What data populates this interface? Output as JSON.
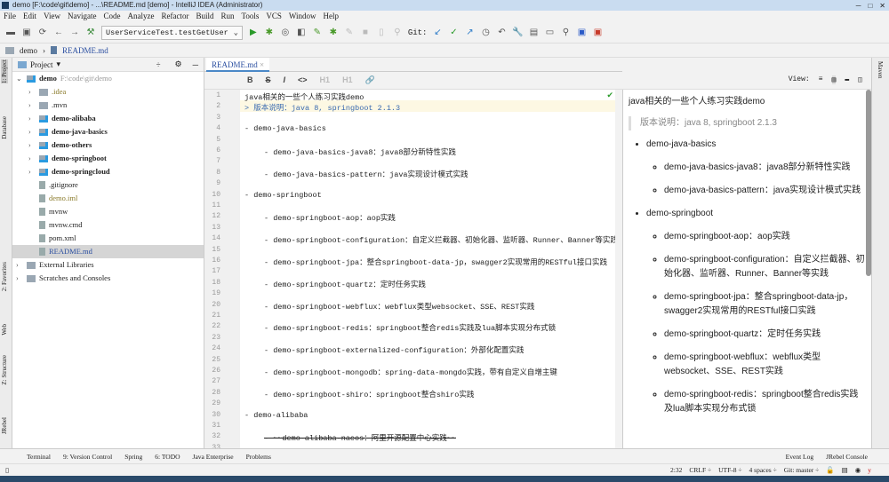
{
  "window": {
    "title": "demo [F:\\code\\git\\demo] - ...\\README.md [demo] - IntelliJ IDEA (Administrator)"
  },
  "menu": [
    "File",
    "Edit",
    "View",
    "Navigate",
    "Code",
    "Analyze",
    "Refactor",
    "Build",
    "Run",
    "Tools",
    "VCS",
    "Window",
    "Help"
  ],
  "toolbar": {
    "run_config": "UserServiceTest.testGetUser",
    "git_label": "Git:"
  },
  "breadcrumb": [
    "demo",
    "README.md"
  ],
  "left_stripe": [
    "1: Project",
    "Database",
    "2: Favorites",
    "Web",
    "Z: Structure",
    "JRebel"
  ],
  "right_stripe": [
    "Maven"
  ],
  "project": {
    "header": "Project",
    "tree": [
      {
        "name": "demo",
        "extra": "F:\\code\\git\\demo",
        "type": "module",
        "level": 0,
        "expanded": true
      },
      {
        "name": ".idea",
        "type": "folder",
        "level": 1
      },
      {
        "name": ".mvn",
        "type": "folder",
        "level": 1
      },
      {
        "name": "demo-alibaba",
        "type": "module",
        "level": 1
      },
      {
        "name": "demo-java-basics",
        "type": "module",
        "level": 1
      },
      {
        "name": "demo-others",
        "type": "module",
        "level": 1
      },
      {
        "name": "demo-springboot",
        "type": "module",
        "level": 1
      },
      {
        "name": "demo-springcloud",
        "type": "module",
        "level": 1
      },
      {
        "name": ".gitignore",
        "type": "file",
        "level": 1
      },
      {
        "name": "demo.iml",
        "type": "file",
        "level": 1
      },
      {
        "name": "mvnw",
        "type": "file",
        "level": 1
      },
      {
        "name": "mvnw.cmd",
        "type": "file",
        "level": 1
      },
      {
        "name": "pom.xml",
        "type": "file",
        "level": 1
      },
      {
        "name": "README.md",
        "type": "file",
        "level": 1,
        "selected": true
      },
      {
        "name": "External Libraries",
        "type": "lib",
        "level": 0
      },
      {
        "name": "Scratches and Consoles",
        "type": "lib",
        "level": 0
      }
    ]
  },
  "editor": {
    "tab": "README.md",
    "md_tools": [
      "B",
      "S",
      "I",
      "<>",
      "H1",
      "H1",
      "🔗"
    ],
    "view_label": "View:",
    "lines": [
      {
        "n": 1,
        "t": "java相关的一些个人练习实践demo",
        "i": 0
      },
      {
        "n": 2,
        "t": "> 版本说明：java 8, springboot 2.1.3",
        "i": 0,
        "q": true
      },
      {
        "n": 3,
        "t": "",
        "i": 0
      },
      {
        "n": 4,
        "t": "- demo-java-basics",
        "i": 0
      },
      {
        "n": 5,
        "t": "",
        "i": 0
      },
      {
        "n": 6,
        "t": "- demo-java-basics-java8：java8部分新特性实践",
        "i": 1
      },
      {
        "n": 7,
        "t": "",
        "i": 0
      },
      {
        "n": 8,
        "t": "- demo-java-basics-pattern：java实现设计模式实践",
        "i": 1
      },
      {
        "n": 9,
        "t": "",
        "i": 0
      },
      {
        "n": 10,
        "t": "- demo-springboot",
        "i": 0
      },
      {
        "n": 11,
        "t": "",
        "i": 0
      },
      {
        "n": 12,
        "t": "- demo-springboot-aop：aop实践",
        "i": 1
      },
      {
        "n": 13,
        "t": "",
        "i": 0
      },
      {
        "n": 14,
        "t": "- demo-springboot-configuration：自定义拦截器、初始化器、监听器、Runner、Banner等实践",
        "i": 1
      },
      {
        "n": 15,
        "t": "",
        "i": 0
      },
      {
        "n": 16,
        "t": "- demo-springboot-jpa：整合springboot-data-jp，swagger2实现常用的RESTful接口实践",
        "i": 1
      },
      {
        "n": 17,
        "t": "",
        "i": 0
      },
      {
        "n": 18,
        "t": "- demo-springboot-quartz：定时任务实践",
        "i": 1
      },
      {
        "n": 19,
        "t": "",
        "i": 0
      },
      {
        "n": 20,
        "t": "- demo-springboot-webflux：webflux类型websocket、SSE、REST实践",
        "i": 1
      },
      {
        "n": 21,
        "t": "",
        "i": 0
      },
      {
        "n": 22,
        "t": "- demo-springboot-redis：springboot整合redis实践及lua脚本实现分布式锁",
        "i": 1
      },
      {
        "n": 23,
        "t": "",
        "i": 0
      },
      {
        "n": 24,
        "t": "- demo-springboot-externalized-configuration：外部化配置实践",
        "i": 1
      },
      {
        "n": 25,
        "t": "",
        "i": 0
      },
      {
        "n": 26,
        "t": "- demo-springboot-mongodb：spring-data-mongdo实践，带有自定义自增主键",
        "i": 1
      },
      {
        "n": 27,
        "t": "",
        "i": 0
      },
      {
        "n": 28,
        "t": "- demo-springboot-shiro：springboot整合shiro实践",
        "i": 1
      },
      {
        "n": 29,
        "t": "",
        "i": 0
      },
      {
        "n": 30,
        "t": "- demo-alibaba",
        "i": 0
      },
      {
        "n": 31,
        "t": "",
        "i": 0
      },
      {
        "n": 32,
        "t": "- ~~demo-alibaba-nacos：阿里开源配置中心实践~~",
        "i": 1
      },
      {
        "n": 33,
        "t": "",
        "i": 0
      }
    ]
  },
  "preview": {
    "title": "java相关的一些个人练习实践demo",
    "quote": "版本说明：java 8, springboot 2.1.3",
    "sections": [
      {
        "name": "demo-java-basics",
        "items": [
          "demo-java-basics-java8：java8部分新特性实践",
          "demo-java-basics-pattern：java实现设计模式实践"
        ]
      },
      {
        "name": "demo-springboot",
        "items": [
          "demo-springboot-aop：aop实践",
          "demo-springboot-configuration：自定义拦截器、初始化器、监听器、Runner、Banner等实践",
          "demo-springboot-jpa：整合springboot-data-jp，swagger2实现常用的RESTful接口实践",
          "demo-springboot-quartz：定时任务实践",
          "demo-springboot-webflux：webflux类型websocket、SSE、REST实践",
          "demo-springboot-redis：springboot整合redis实践及lua脚本实现分布式锁"
        ]
      }
    ]
  },
  "bottom_tools": [
    "Terminal",
    "9: Version Control",
    "Spring",
    "6: TODO",
    "Java Enterprise",
    "Problems"
  ],
  "bottom_tools_right": [
    "Event Log",
    "JRebel Console"
  ],
  "status": {
    "position": "2:32",
    "line_sep": "CRLF ÷",
    "encoding": "UTF-8 ÷",
    "indent": "4 spaces ÷",
    "git": "Git: master ÷"
  }
}
